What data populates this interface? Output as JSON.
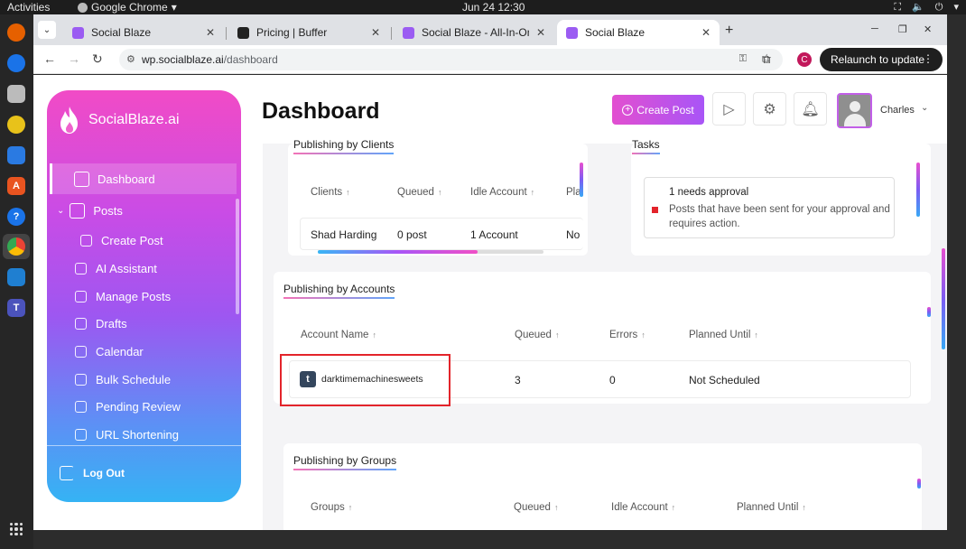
{
  "os": {
    "activities": "Activities",
    "app_name": "Google Chrome",
    "clock": "Jun 24  12:30"
  },
  "browser": {
    "tabs": [
      {
        "title": "Social Blaze",
        "favicon_color": "#9b5cf2"
      },
      {
        "title": "Pricing | Buffer",
        "favicon_color": "#222222"
      },
      {
        "title": "Social Blaze - All-In-One",
        "favicon_color": "#9b5cf2"
      },
      {
        "title": "Social Blaze",
        "favicon_color": "#9b5cf2"
      }
    ],
    "url_host": "wp.socialblaze.ai",
    "url_path": "/dashboard",
    "profile_initial": "C",
    "relaunch_label": "Relaunch to update"
  },
  "sidebar": {
    "brand": "SocialBlaze.ai",
    "items": [
      {
        "label": "Dashboard"
      },
      {
        "label": "Posts"
      },
      {
        "label": "Create Post"
      },
      {
        "label": "AI Assistant"
      },
      {
        "label": "Manage Posts"
      },
      {
        "label": "Drafts"
      },
      {
        "label": "Calendar"
      },
      {
        "label": "Bulk Schedule"
      },
      {
        "label": "Pending Review"
      },
      {
        "label": "URL Shortening"
      }
    ],
    "logout": "Log Out"
  },
  "header": {
    "title": "Dashboard",
    "create_post": "Create Post",
    "user_name": "Charles"
  },
  "clients": {
    "title": "Publishing by Clients",
    "columns": [
      "Clients",
      "Queued",
      "Idle Account",
      "Pla"
    ],
    "row": [
      "Shad Harding",
      "0 post",
      "1 Account",
      "No"
    ]
  },
  "tasks": {
    "title": "Tasks",
    "headline": "1 needs approval",
    "detail": "Posts that have been sent for your approval and requires action."
  },
  "accounts": {
    "title": "Publishing by Accounts",
    "columns": [
      "Account Name",
      "Queued",
      "Errors",
      "Planned Until"
    ],
    "row": {
      "name": "darktimemachinesweets",
      "queued": "3",
      "errors": "0",
      "planned": "Not Scheduled"
    }
  },
  "groups": {
    "title": "Publishing by Groups",
    "columns": [
      "Groups",
      "Queued",
      "Idle Account",
      "Planned Until"
    ]
  }
}
